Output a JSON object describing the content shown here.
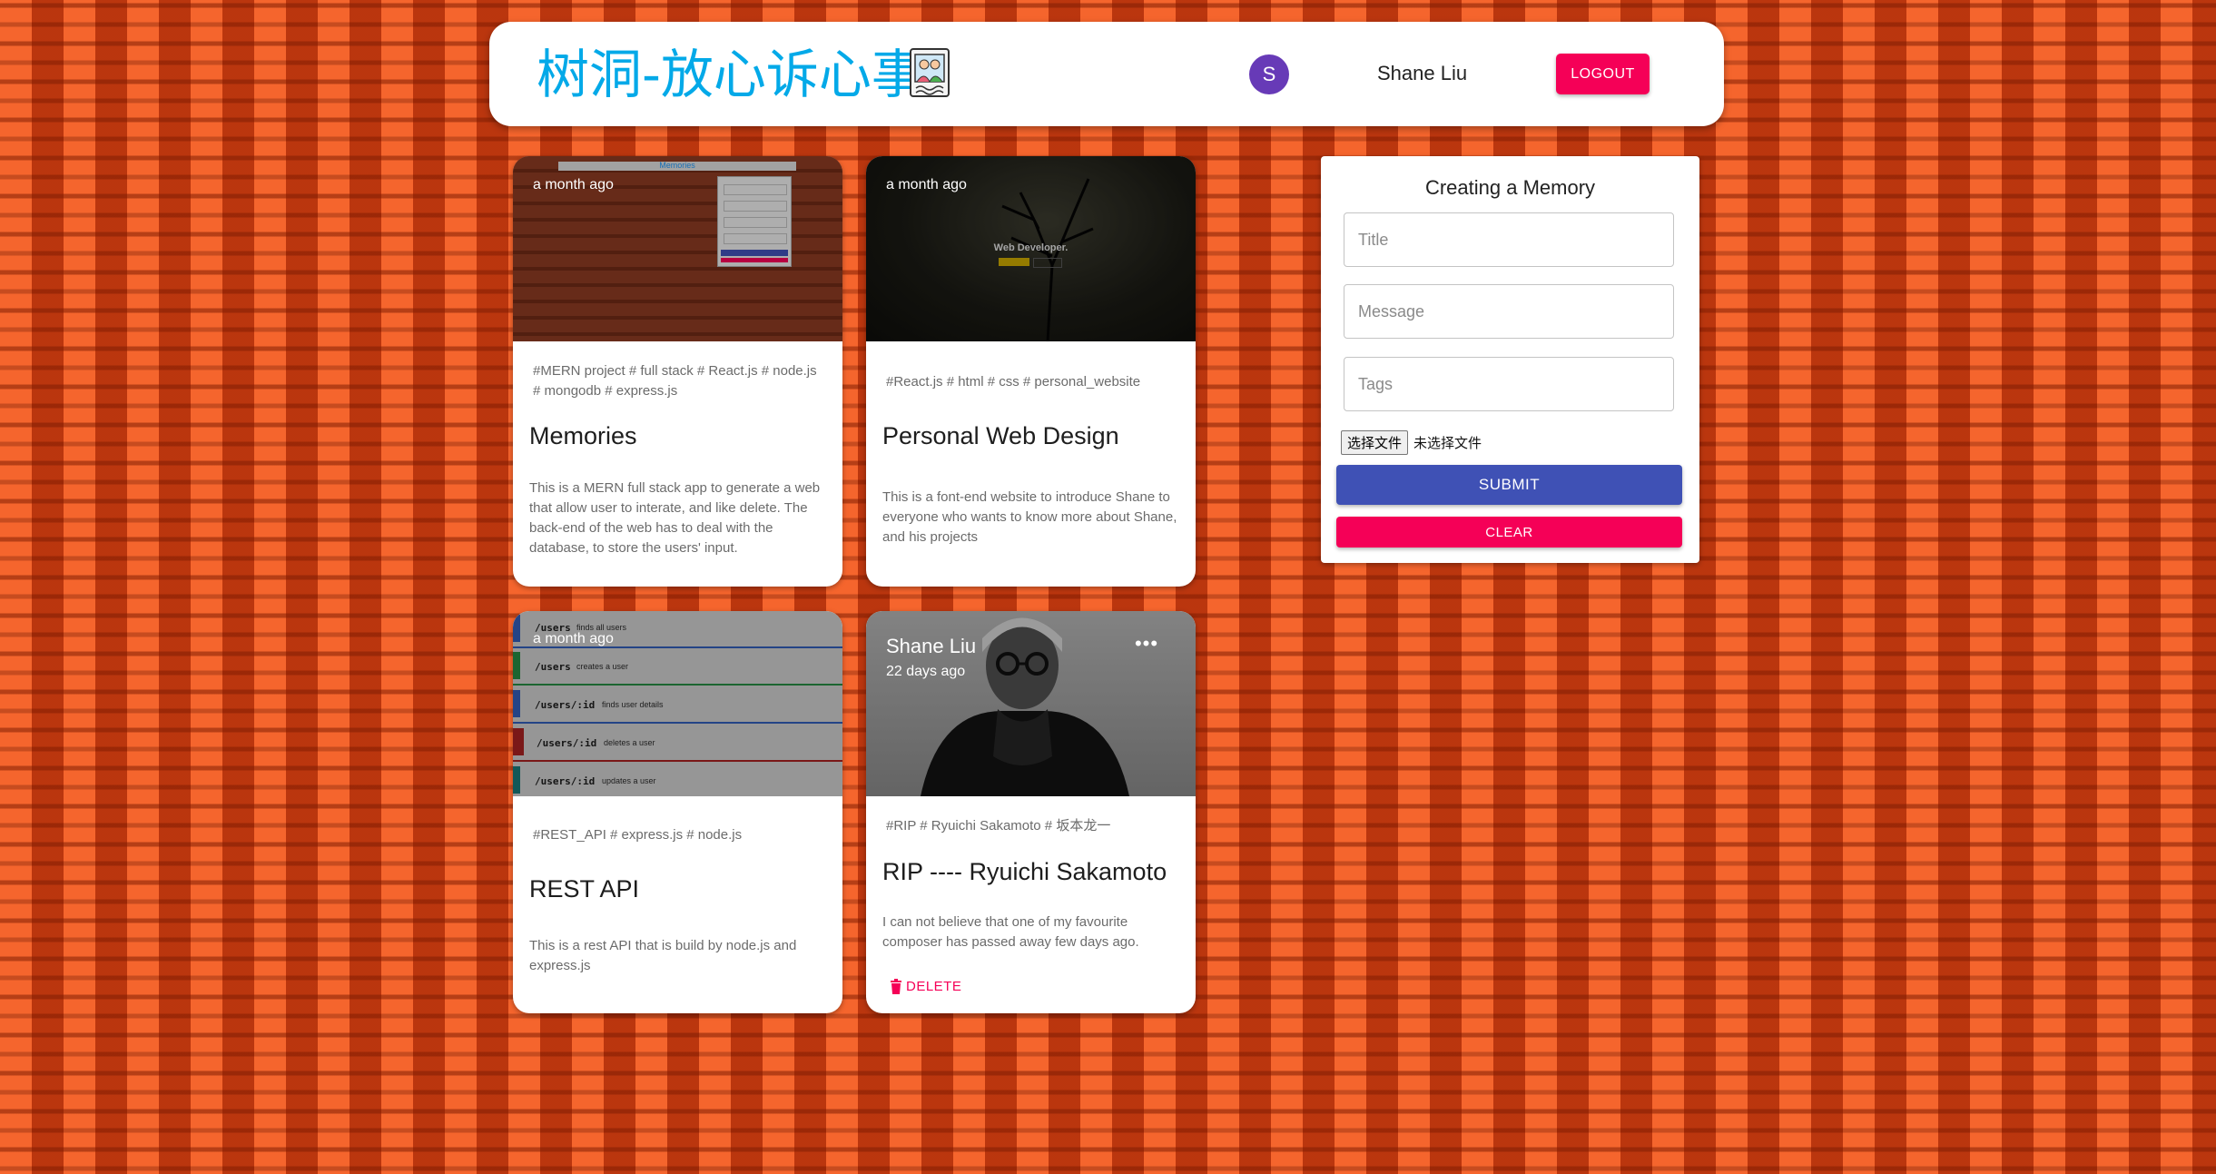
{
  "header": {
    "brand": "树洞-放心诉心事",
    "avatar_letter": "S",
    "user_name": "Shane Liu",
    "logout_label": "LOGOUT"
  },
  "posts": [
    {
      "time": "a month ago",
      "tags": "#MERN project # full stack # React.js # node.js # mongodb # express.js",
      "title": "Memories",
      "message": "This is a MERN full stack app to generate a web that allow user to interate, and like delete. The back-end of the web has to deal with the database, to store the users' input.",
      "thumb_title": "Memories"
    },
    {
      "time": "a month ago",
      "tags": "#React.js # html # css # personal_website",
      "title": "Personal Web Design",
      "message": "This is a font-end website to introduce Shane to everyone who wants to know more about Shane, and his projects",
      "thumb_heading": "Web Developer."
    },
    {
      "time": "a month ago",
      "tags": "#REST_API # express.js # node.js",
      "title": "REST API",
      "message": "This is a rest API that is build by node.js and express.js",
      "routes": [
        {
          "path": "/users",
          "desc": "finds all users"
        },
        {
          "path": "/users",
          "desc": "creates a user"
        },
        {
          "path": "/users/:id",
          "desc": "finds user details"
        },
        {
          "path": "/users/:id",
          "desc": "deletes a user"
        },
        {
          "path": "/users/:id",
          "desc": "updates a user"
        }
      ]
    },
    {
      "author": "Shane Liu",
      "time": "22 days ago",
      "more_label": "•••",
      "tags": "#RIP # Ryuichi Sakamoto # 坂本龙一",
      "title": "RIP ---- Ryuichi Sakamoto",
      "message": "I can not believe that one of my favourite composer has passed away few days ago.",
      "delete_label": "DELETE"
    }
  ],
  "form": {
    "title": "Creating a Memory",
    "title_placeholder": "Title",
    "message_placeholder": "Message",
    "tags_placeholder": "Tags",
    "file_button": "选择文件",
    "file_status": "未选择文件",
    "submit_label": "SUBMIT",
    "clear_label": "CLEAR"
  },
  "colors": {
    "brand": "#03a9e8",
    "primary": "#3f51b5",
    "secondary": "#f50057",
    "avatar": "#673ab7",
    "background": "#e84e1c"
  }
}
